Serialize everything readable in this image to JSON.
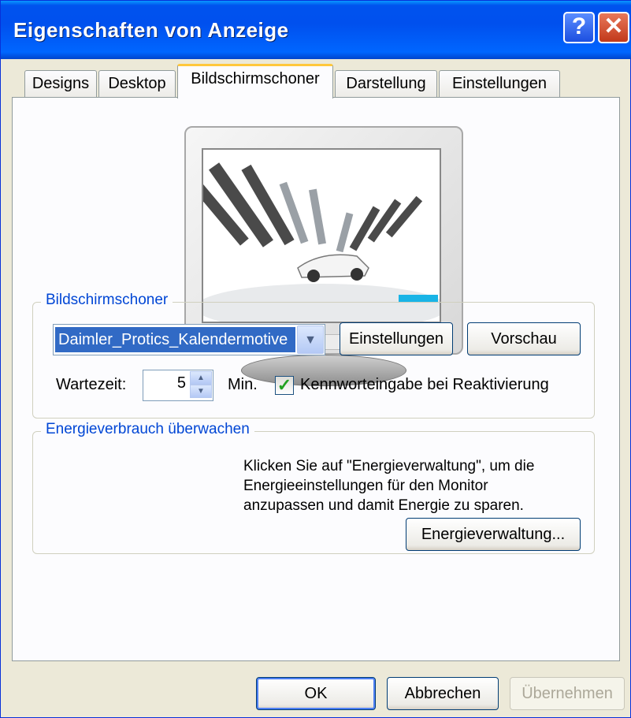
{
  "window": {
    "title": "Eigenschaften von Anzeige"
  },
  "titlebar": {
    "help_label": "?",
    "close_label": "✕"
  },
  "tabs": [
    {
      "label": "Designs"
    },
    {
      "label": "Desktop"
    },
    {
      "label": "Bildschirmschoner",
      "active": true
    },
    {
      "label": "Darstellung"
    },
    {
      "label": "Einstellungen"
    }
  ],
  "screensaver": {
    "group_label": "Bildschirmschoner",
    "selected": "Daimler_Protics_Kalendermotive",
    "settings_button": "Einstellungen",
    "preview_button": "Vorschau",
    "wait_label": "Wartezeit:",
    "wait_value": "5",
    "wait_unit": "Min.",
    "password_checked": true,
    "password_label": "Kennworteingabe bei Reaktivierung"
  },
  "energy": {
    "group_label": "Energieverbrauch überwachen",
    "line1": "Klicken Sie auf \"Energieverwaltung\", um die",
    "line2": "Energieeinstellungen für den Monitor",
    "line3": "anzupassen und damit Energie zu sparen.",
    "button": "Energieverwaltung..."
  },
  "footer": {
    "ok": "OK",
    "cancel": "Abbrechen",
    "apply": "Übernehmen"
  },
  "colors": {
    "accent": "#0046d5",
    "titlebar": "#0053ee",
    "selection": "#316ac5",
    "check": "#21a121"
  },
  "icons": [
    "help-icon",
    "close-icon",
    "chevron-down-icon",
    "spin-up-icon",
    "spin-down-icon",
    "checkmark-icon"
  ]
}
